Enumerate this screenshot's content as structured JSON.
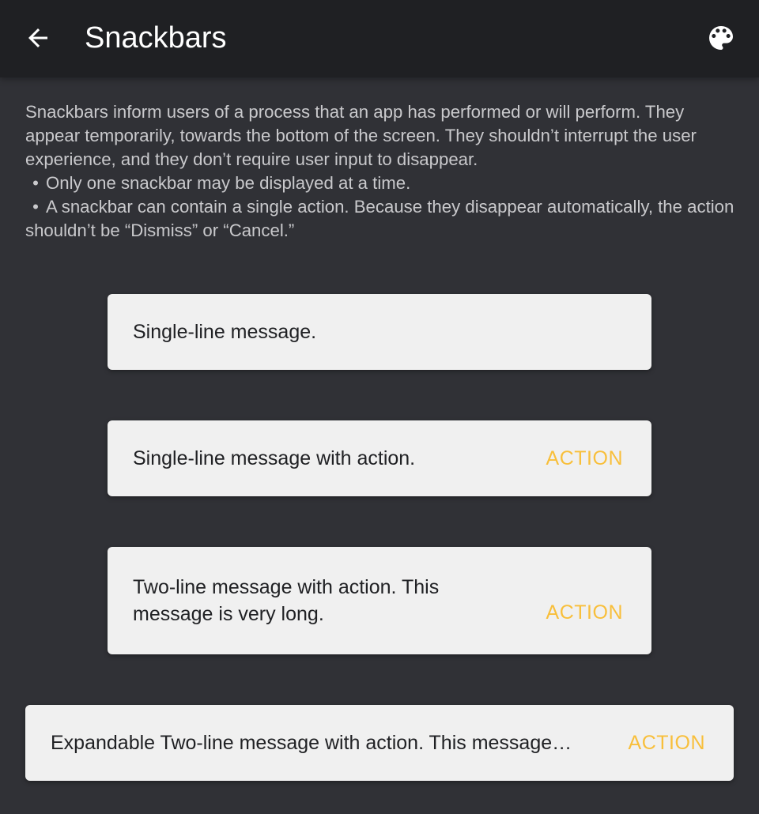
{
  "appbar": {
    "title": "Snackbars",
    "back_icon": "arrow-left-icon",
    "palette_icon": "palette-icon"
  },
  "description": {
    "paragraph": "Snackbars inform users of a process that an app has performed or will perform. They appear temporarily, towards the bottom of the screen. They shouldn’t interrupt the user experience, and they don’t require user input to disappear.",
    "bullet_char": "•",
    "bullets": [
      "Only one snackbar may be displayed at a time.",
      "A snackbar can contain a single action. Because they disappear automatically, the action shouldn’t be “Dismiss” or “Cancel.”"
    ]
  },
  "snackbars": [
    {
      "message": "Single-line message."
    },
    {
      "message": "Single-line message with action.",
      "action": "ACTION"
    },
    {
      "message": "Two-line message with action. This message is very long.",
      "action": "ACTION"
    },
    {
      "message": "Expandable Two-line message with action. This message is very long.",
      "action": "ACTION"
    }
  ],
  "colors": {
    "background": "#303136",
    "appbar": "#1f2023",
    "snackbar": "#f0f0f0",
    "action": "#f8bf3b"
  }
}
